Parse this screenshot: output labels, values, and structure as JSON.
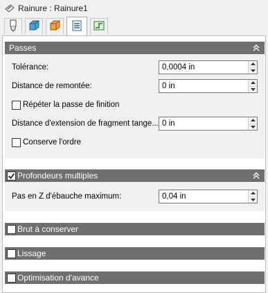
{
  "window": {
    "title": "Rainure : Rainure1",
    "title_icon": "groove-icon"
  },
  "tabs": [
    {
      "name": "tool-tab",
      "icon": "tool-icon"
    },
    {
      "name": "geometry-tab",
      "icon": "geometry-icon"
    },
    {
      "name": "heights-tab",
      "icon": "heights-icon"
    },
    {
      "name": "passes-tab",
      "icon": "passes-icon",
      "active": true
    },
    {
      "name": "linking-tab",
      "icon": "linking-icon"
    }
  ],
  "passes": {
    "title": "Passes",
    "tolerance_label": "Tolérance:",
    "tolerance_value": "0,0004 in",
    "retract_label": "Distance de remontée:",
    "retract_value": "0 in",
    "repeat_finish_label": "Répéter la passe de finition",
    "fragment_label": "Distance d'extension de fragment tange...",
    "fragment_value": "0 in",
    "keep_order_label": "Conserve l'ordre"
  },
  "multi_depths": {
    "title": "Profondeurs multiples",
    "checked": true,
    "max_roughing_label": "Pas en Z d'ébauche maximum:",
    "max_roughing_value": "0,04 in"
  },
  "stock_to_leave": {
    "title": "Brut à conserver"
  },
  "smoothing": {
    "title": "Lissage"
  },
  "feed_optimization": {
    "title": "Optimisation d'avance"
  }
}
